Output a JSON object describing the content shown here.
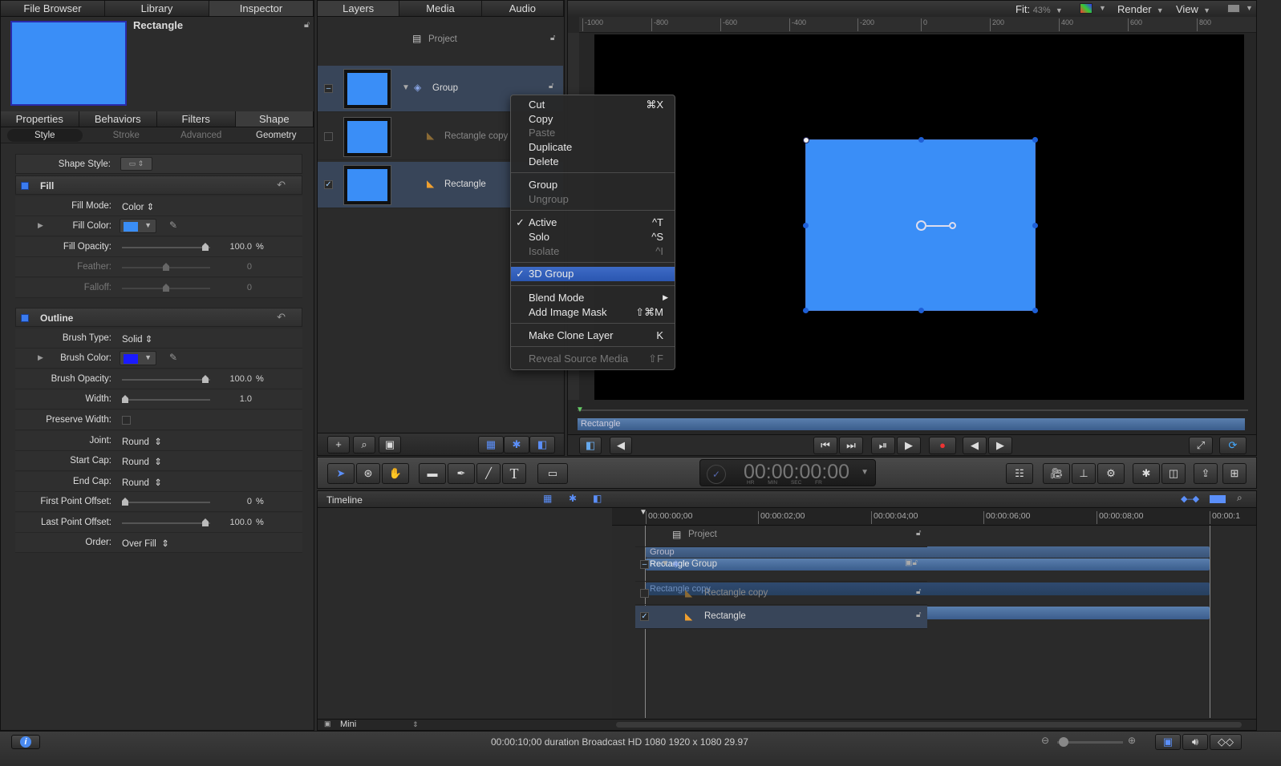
{
  "inspector": {
    "tabs": [
      "File Browser",
      "Library",
      "Inspector"
    ],
    "object_name": "Rectangle",
    "subtabs": [
      "Properties",
      "Behaviors",
      "Filters",
      "Shape"
    ],
    "shape_tabs": [
      "Style",
      "Stroke",
      "Advanced",
      "Geometry"
    ],
    "shape_style_label": "Shape Style:",
    "fill": {
      "title": "Fill",
      "fill_mode_label": "Fill Mode:",
      "fill_mode": "Color",
      "fill_color_label": "Fill Color:",
      "fill_color": "#3a8ef7",
      "fill_opacity_label": "Fill Opacity:",
      "fill_opacity": "100.0",
      "feather_label": "Feather:",
      "feather": "0",
      "falloff_label": "Falloff:",
      "falloff": "0",
      "pct": "%"
    },
    "outline": {
      "title": "Outline",
      "brush_type_label": "Brush Type:",
      "brush_type": "Solid",
      "brush_color_label": "Brush Color:",
      "brush_color": "#1a1aff",
      "brush_opacity_label": "Brush Opacity:",
      "brush_opacity": "100.0",
      "width_label": "Width:",
      "width": "1.0",
      "preserve_width_label": "Preserve Width:",
      "joint_label": "Joint:",
      "joint": "Round",
      "start_cap_label": "Start Cap:",
      "start_cap": "Round",
      "end_cap_label": "End Cap:",
      "end_cap": "Round",
      "first_point_label": "First Point Offset:",
      "first_point": "0",
      "last_point_label": "Last Point Offset:",
      "last_point": "100.0",
      "order_label": "Order:",
      "order": "Over Fill",
      "pct": "%"
    }
  },
  "layers": {
    "tabs": [
      "Layers",
      "Media",
      "Audio"
    ],
    "items": [
      {
        "name": "Project"
      },
      {
        "name": "Group",
        "checked": false
      },
      {
        "name": "Rectangle copy",
        "checked": false
      },
      {
        "name": "Rectangle",
        "checked": true
      }
    ]
  },
  "context_menu": {
    "items": [
      {
        "label": "Cut",
        "shortcut": "⌘X"
      },
      {
        "label": "Copy"
      },
      {
        "label": "Paste",
        "disabled": true
      },
      {
        "label": "Duplicate"
      },
      {
        "label": "Delete"
      },
      {
        "label": "Group"
      },
      {
        "label": "Ungroup",
        "disabled": true
      },
      {
        "label": "Active",
        "shortcut": "^T",
        "checked": true
      },
      {
        "label": "Solo",
        "shortcut": "^S"
      },
      {
        "label": "Isolate",
        "shortcut": "^I",
        "disabled": true
      },
      {
        "label": "3D Group",
        "checked": true,
        "highlighted": true
      },
      {
        "label": "Blend Mode",
        "submenu": true
      },
      {
        "label": "Add Image Mask",
        "shortcut": "⇧⌘M"
      },
      {
        "label": "Make Clone Layer",
        "shortcut": "K"
      },
      {
        "label": "Reveal Source Media",
        "shortcut": "⇧F",
        "disabled": true
      }
    ],
    "check": "✓",
    "arrow": "▶"
  },
  "canvas": {
    "fit_label": "Fit:",
    "zoom": "43%",
    "render": "Render",
    "view": "View",
    "ruler": [
      "-1000",
      "-800",
      "-600",
      "-400",
      "-200",
      "0",
      "200",
      "400",
      "600",
      "800"
    ],
    "shape_color": "#3a8ef7",
    "mini_timeline_label": "Rectangle"
  },
  "timecode": {
    "value": "00:00:00:00",
    "units": [
      "HR",
      "MIN",
      "SEC",
      "FR"
    ]
  },
  "timeline": {
    "title": "Timeline",
    "ruler": [
      "00:00:00;00",
      "00:00:02;00",
      "00:00:04;00",
      "00:00:06;00",
      "00:00:08;00",
      "00:00:1"
    ],
    "rows": [
      {
        "name": "Project"
      },
      {
        "name": "Group"
      },
      {
        "name": "Rectangle copy"
      },
      {
        "name": "Rectangle"
      }
    ],
    "bars": {
      "group": "Group",
      "group_child": "Rectangle",
      "rect_copy": "Rectangle copy",
      "rect": "Rectangle"
    },
    "mini_label": "Mini"
  },
  "status": {
    "text": "00:00:10;00 duration Broadcast HD 1080 1920 x 1080 29.97",
    "info": "i"
  }
}
